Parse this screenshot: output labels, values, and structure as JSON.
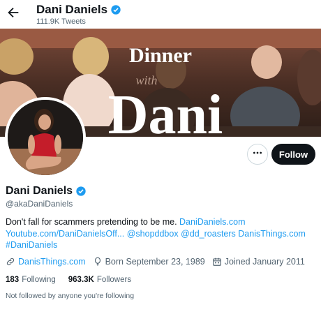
{
  "header": {
    "name": "Dani Daniels",
    "tweet_count": "111.9K Tweets"
  },
  "banner": {
    "title_line1": "Dinner",
    "title_line2": "with",
    "title_line3": "Dani"
  },
  "actions": {
    "follow_label": "Follow",
    "more_icon": "more-horizontal-icon"
  },
  "profile": {
    "name": "Dani Daniels",
    "handle": "@akaDaniDaniels",
    "bio_text1": "Don't fall for scammers pretending to be me. ",
    "bio_link1": "DaniDaniels.com",
    "bio_link2": "Youtube.com/DaniDanielsOff...",
    "bio_link3": "@shopddbox",
    "bio_link4": "@dd_roasters",
    "bio_link5": "DanisThings.com",
    "bio_link6": "#DaniDaniels"
  },
  "meta": {
    "website": "DanisThings.com",
    "birthday": "Born September 23, 1989",
    "joined": "Joined January 2011"
  },
  "counts": {
    "following_num": "183",
    "following_label": "Following",
    "followers_num": "963.3K",
    "followers_label": "Followers"
  },
  "not_followed": "Not followed by anyone you're following",
  "colors": {
    "accent": "#1d9bf0",
    "text": "#0f1419",
    "muted": "#536471"
  }
}
